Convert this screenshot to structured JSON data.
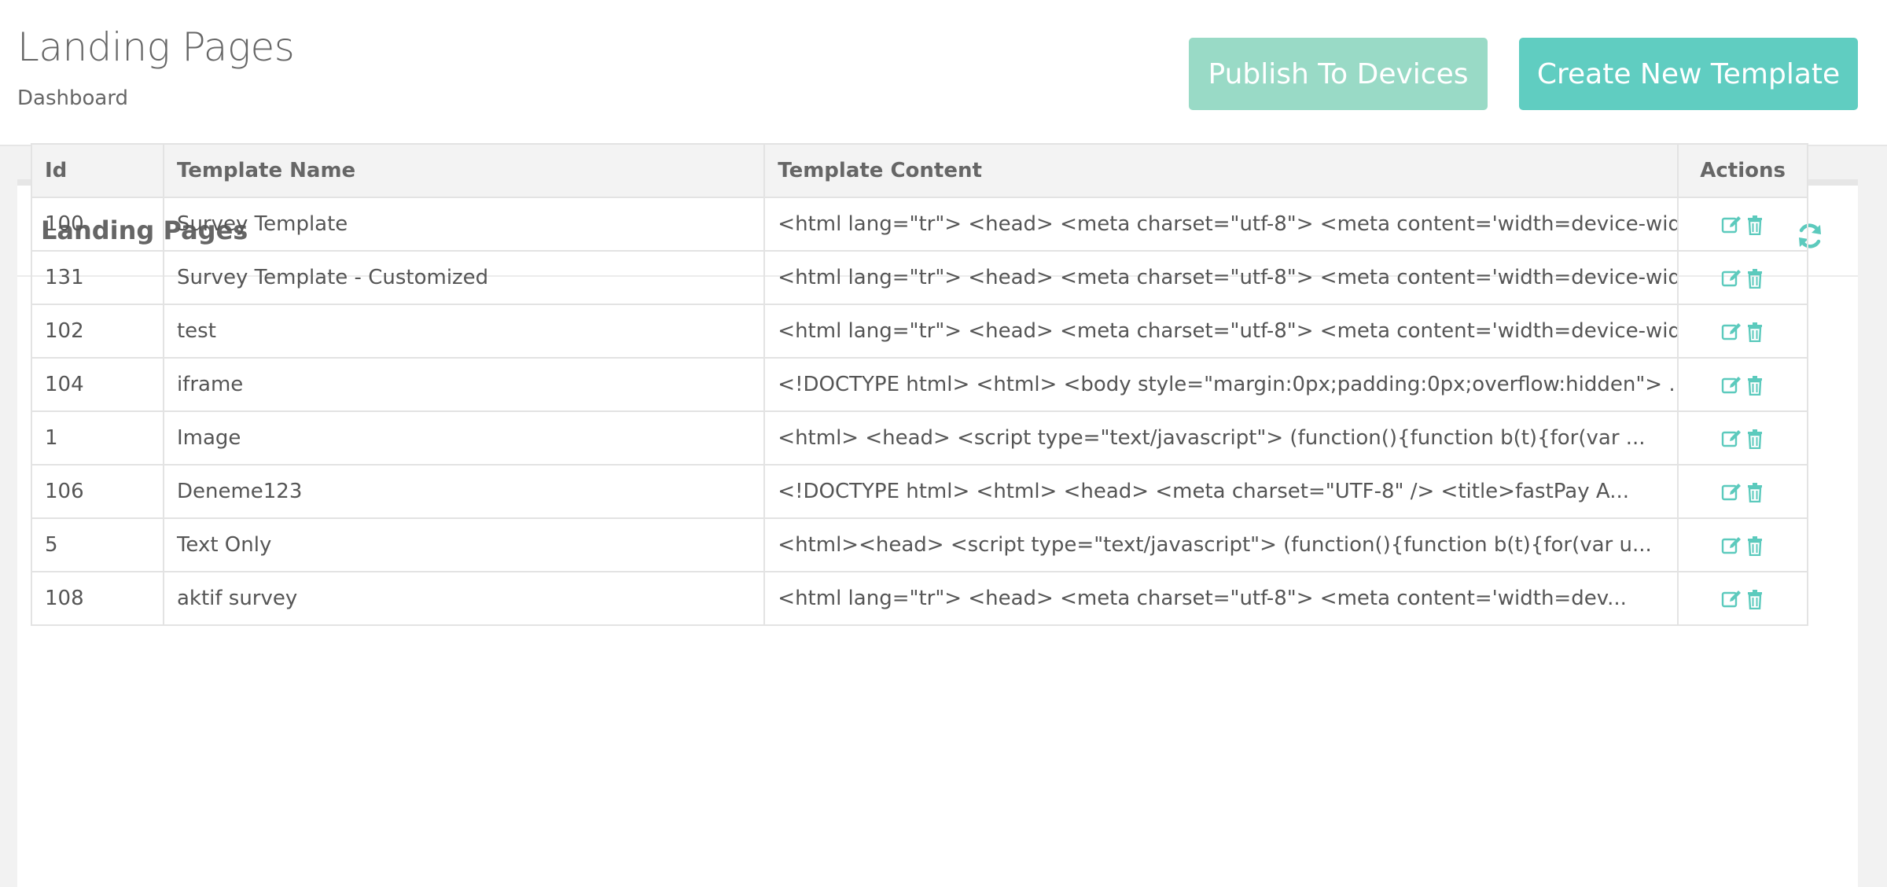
{
  "header": {
    "title": "Landing Pages",
    "breadcrumb": "Dashboard",
    "publish_label": "Publish To Devices",
    "create_label": "Create New Template"
  },
  "panel": {
    "title": "Landing Pages",
    "refresh_icon": "refresh-icon"
  },
  "table": {
    "columns": [
      "Id",
      "Template Name",
      "Template Content",
      "Actions"
    ],
    "rows": [
      {
        "id": "100",
        "name": "Survey Template",
        "content": "<html lang=\"tr\"> <head> <meta charset=\"utf-8\"> <meta content='width=device-width..."
      },
      {
        "id": "131",
        "name": "Survey Template - Customized",
        "content": "<html lang=\"tr\"> <head> <meta charset=\"utf-8\"> <meta content='width=device-width..."
      },
      {
        "id": "102",
        "name": "test",
        "content": "<html lang=\"tr\"> <head> <meta charset=\"utf-8\"> <meta content='width=device-width..."
      },
      {
        "id": "104",
        "name": "iframe",
        "content": "<!DOCTYPE html> <html> <body style=\"margin:0px;padding:0px;overflow:hidden\"> ..."
      },
      {
        "id": "1",
        "name": "Image",
        "content": "<html> <head> <script type=\"text/javascript\"> (function(){function b(t){for(var ..."
      },
      {
        "id": "106",
        "name": "Deneme123",
        "content": "<!DOCTYPE html> <html> <head> <meta charset=\"UTF-8\" /> <title>fastPay A..."
      },
      {
        "id": "5",
        "name": "Text Only",
        "content": "<html><head> <script type=\"text/javascript\"> (function(){function b(t){for(var u..."
      },
      {
        "id": "108",
        "name": "aktif survey",
        "content": "<html lang=\"tr\"> <head> <meta charset=\"utf-8\"> <meta content='width=dev..."
      }
    ],
    "action_icons": [
      "edit-icon",
      "trash-icon"
    ]
  },
  "colors": {
    "publish_button": "#99dac6",
    "create_button": "#60cdc1",
    "icon_teal": "#5ccabd"
  }
}
